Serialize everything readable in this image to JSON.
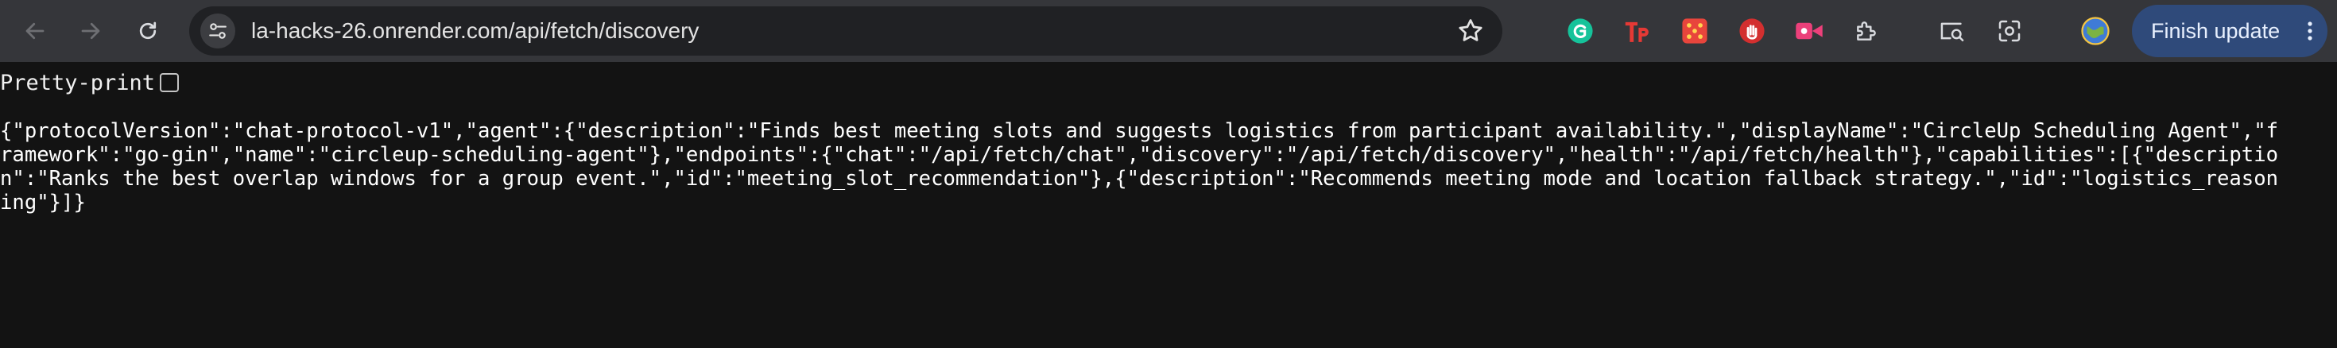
{
  "browser": {
    "url": "la-hacks-26.onrender.com/api/fetch/discovery",
    "update_button_label": "Finish update",
    "nav": [
      "back-icon",
      "forward-icon",
      "reload-icon"
    ],
    "extensions": [
      "grammarly-icon",
      "tp-extension-icon",
      "puzzle-grid-extension-icon",
      "hand-stop-extension-icon",
      "video-extension-icon",
      "extensions-puzzle-icon",
      "tab-search-icon",
      "lens-icon",
      "profile-avatar-icon"
    ]
  },
  "page": {
    "pretty_print_label": "Pretty-print",
    "pretty_print_checked": false,
    "json_text": "{\"protocolVersion\":\"chat-protocol-v1\",\"agent\":{\"description\":\"Finds best meeting slots and suggests logistics from participant availability.\",\"displayName\":\"CircleUp Scheduling Agent\",\"framework\":\"go-gin\",\"name\":\"circleup-scheduling-agent\"},\"endpoints\":{\"chat\":\"/api/fetch/chat\",\"discovery\":\"/api/fetch/discovery\",\"health\":\"/api/fetch/health\"},\"capabilities\":[{\"description\":\"Ranks the best overlap windows for a group event.\",\"id\":\"meeting_slot_recommendation\"},{\"description\":\"Recommends meeting mode and location fallback strategy.\",\"id\":\"logistics_reasoning\"}]}"
  }
}
